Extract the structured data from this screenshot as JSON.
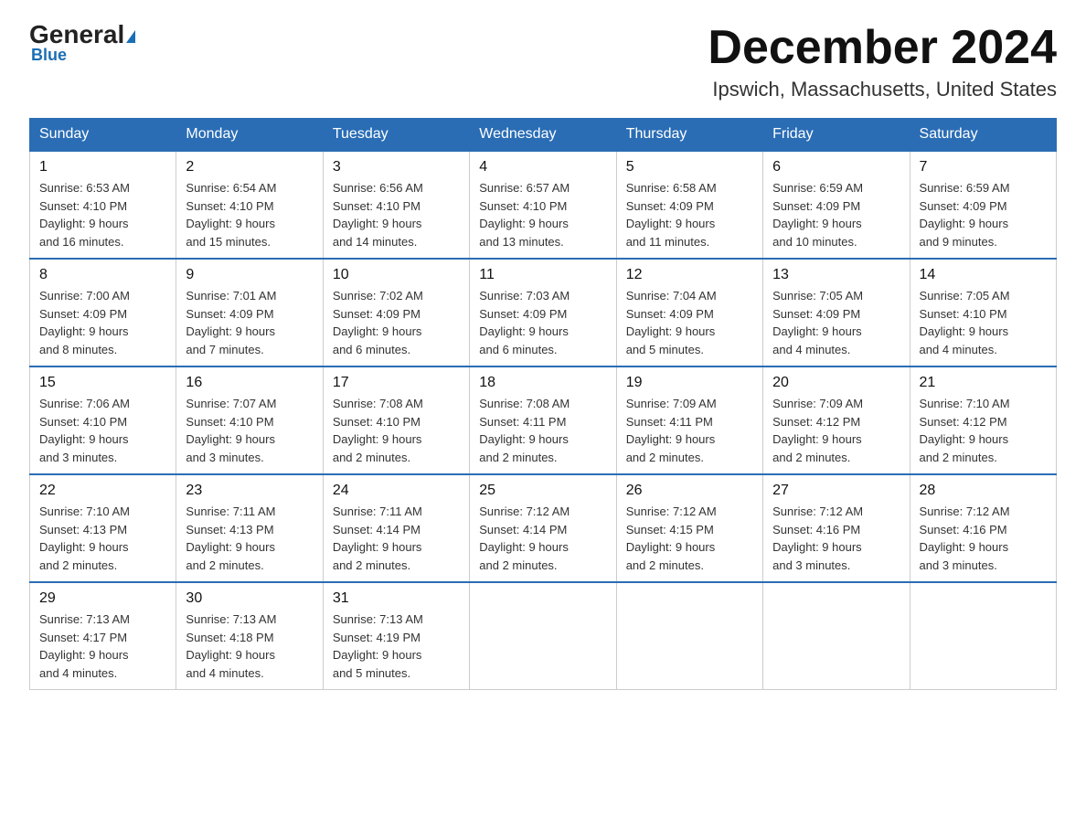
{
  "header": {
    "logo_general": "General",
    "logo_blue": "Blue",
    "month_title": "December 2024",
    "location": "Ipswich, Massachusetts, United States"
  },
  "weekdays": [
    "Sunday",
    "Monday",
    "Tuesday",
    "Wednesday",
    "Thursday",
    "Friday",
    "Saturday"
  ],
  "weeks": [
    [
      {
        "day": "1",
        "sunrise": "6:53 AM",
        "sunset": "4:10 PM",
        "daylight": "9 hours and 16 minutes."
      },
      {
        "day": "2",
        "sunrise": "6:54 AM",
        "sunset": "4:10 PM",
        "daylight": "9 hours and 15 minutes."
      },
      {
        "day": "3",
        "sunrise": "6:56 AM",
        "sunset": "4:10 PM",
        "daylight": "9 hours and 14 minutes."
      },
      {
        "day": "4",
        "sunrise": "6:57 AM",
        "sunset": "4:10 PM",
        "daylight": "9 hours and 13 minutes."
      },
      {
        "day": "5",
        "sunrise": "6:58 AM",
        "sunset": "4:09 PM",
        "daylight": "9 hours and 11 minutes."
      },
      {
        "day": "6",
        "sunrise": "6:59 AM",
        "sunset": "4:09 PM",
        "daylight": "9 hours and 10 minutes."
      },
      {
        "day": "7",
        "sunrise": "6:59 AM",
        "sunset": "4:09 PM",
        "daylight": "9 hours and 9 minutes."
      }
    ],
    [
      {
        "day": "8",
        "sunrise": "7:00 AM",
        "sunset": "4:09 PM",
        "daylight": "9 hours and 8 minutes."
      },
      {
        "day": "9",
        "sunrise": "7:01 AM",
        "sunset": "4:09 PM",
        "daylight": "9 hours and 7 minutes."
      },
      {
        "day": "10",
        "sunrise": "7:02 AM",
        "sunset": "4:09 PM",
        "daylight": "9 hours and 6 minutes."
      },
      {
        "day": "11",
        "sunrise": "7:03 AM",
        "sunset": "4:09 PM",
        "daylight": "9 hours and 6 minutes."
      },
      {
        "day": "12",
        "sunrise": "7:04 AM",
        "sunset": "4:09 PM",
        "daylight": "9 hours and 5 minutes."
      },
      {
        "day": "13",
        "sunrise": "7:05 AM",
        "sunset": "4:09 PM",
        "daylight": "9 hours and 4 minutes."
      },
      {
        "day": "14",
        "sunrise": "7:05 AM",
        "sunset": "4:10 PM",
        "daylight": "9 hours and 4 minutes."
      }
    ],
    [
      {
        "day": "15",
        "sunrise": "7:06 AM",
        "sunset": "4:10 PM",
        "daylight": "9 hours and 3 minutes."
      },
      {
        "day": "16",
        "sunrise": "7:07 AM",
        "sunset": "4:10 PM",
        "daylight": "9 hours and 3 minutes."
      },
      {
        "day": "17",
        "sunrise": "7:08 AM",
        "sunset": "4:10 PM",
        "daylight": "9 hours and 2 minutes."
      },
      {
        "day": "18",
        "sunrise": "7:08 AM",
        "sunset": "4:11 PM",
        "daylight": "9 hours and 2 minutes."
      },
      {
        "day": "19",
        "sunrise": "7:09 AM",
        "sunset": "4:11 PM",
        "daylight": "9 hours and 2 minutes."
      },
      {
        "day": "20",
        "sunrise": "7:09 AM",
        "sunset": "4:12 PM",
        "daylight": "9 hours and 2 minutes."
      },
      {
        "day": "21",
        "sunrise": "7:10 AM",
        "sunset": "4:12 PM",
        "daylight": "9 hours and 2 minutes."
      }
    ],
    [
      {
        "day": "22",
        "sunrise": "7:10 AM",
        "sunset": "4:13 PM",
        "daylight": "9 hours and 2 minutes."
      },
      {
        "day": "23",
        "sunrise": "7:11 AM",
        "sunset": "4:13 PM",
        "daylight": "9 hours and 2 minutes."
      },
      {
        "day": "24",
        "sunrise": "7:11 AM",
        "sunset": "4:14 PM",
        "daylight": "9 hours and 2 minutes."
      },
      {
        "day": "25",
        "sunrise": "7:12 AM",
        "sunset": "4:14 PM",
        "daylight": "9 hours and 2 minutes."
      },
      {
        "day": "26",
        "sunrise": "7:12 AM",
        "sunset": "4:15 PM",
        "daylight": "9 hours and 2 minutes."
      },
      {
        "day": "27",
        "sunrise": "7:12 AM",
        "sunset": "4:16 PM",
        "daylight": "9 hours and 3 minutes."
      },
      {
        "day": "28",
        "sunrise": "7:12 AM",
        "sunset": "4:16 PM",
        "daylight": "9 hours and 3 minutes."
      }
    ],
    [
      {
        "day": "29",
        "sunrise": "7:13 AM",
        "sunset": "4:17 PM",
        "daylight": "9 hours and 4 minutes."
      },
      {
        "day": "30",
        "sunrise": "7:13 AM",
        "sunset": "4:18 PM",
        "daylight": "9 hours and 4 minutes."
      },
      {
        "day": "31",
        "sunrise": "7:13 AM",
        "sunset": "4:19 PM",
        "daylight": "9 hours and 5 minutes."
      },
      null,
      null,
      null,
      null
    ]
  ]
}
